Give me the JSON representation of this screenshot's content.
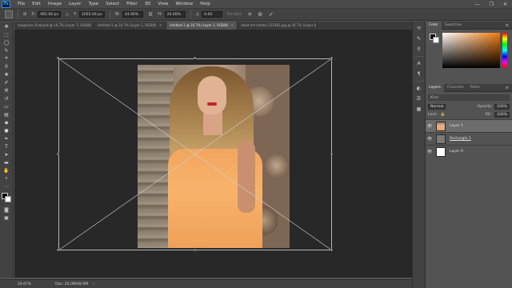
{
  "app": {
    "logo": "Ps"
  },
  "menu": [
    "File",
    "Edit",
    "Image",
    "Layer",
    "Type",
    "Select",
    "Filter",
    "3D",
    "View",
    "Window",
    "Help"
  ],
  "window_controls": [
    "—",
    "❐",
    "✕"
  ],
  "options_bar": {
    "x_value": "965.00 px",
    "y_value": "1055.00 px",
    "w_value": "24.00%",
    "h_value": "24.00%",
    "angle_value": "0.00",
    "interp_label": "Bicubic",
    "cancel_icon": "cancel-icon",
    "commit_icon": "commit-icon"
  },
  "tabs": [
    {
      "label": "magazine_final.psd @ 16.7% (Layer 7, RGB/8)",
      "active": false
    },
    {
      "label": "Untitled-1 @ 16.7% (Layer 1, RGB/8)",
      "active": false
    },
    {
      "label": "Untitled-1 @ 16.7% (Layer 1, RGB/8)",
      "active": true
    },
    {
      "label": "adult-art-artistic-131462.jpg @ 16.7% (Layer 0, RGB/8)",
      "active": false
    }
  ],
  "status": {
    "zoom": "16.67%",
    "doc": "Doc: 24.0M/48.0M"
  },
  "color_panel": {
    "tabs": [
      "Color",
      "Swatches"
    ]
  },
  "layers_panel": {
    "tabs": [
      "Layers",
      "Channels",
      "Paths"
    ],
    "filter_placeholder": "Kind",
    "blend_mode": "Normal",
    "opacity_label": "Opacity:",
    "opacity_value": "100%",
    "lock_label": "Lock:",
    "fill_label": "Fill:",
    "fill_value": "100%",
    "layers": [
      {
        "name": "Layer 1",
        "selected": true,
        "thumb": "photo"
      },
      {
        "name": "Rectangle 1",
        "selected": false,
        "thumb": "gray"
      },
      {
        "name": "Layer 0",
        "selected": false,
        "thumb": "white"
      }
    ]
  }
}
